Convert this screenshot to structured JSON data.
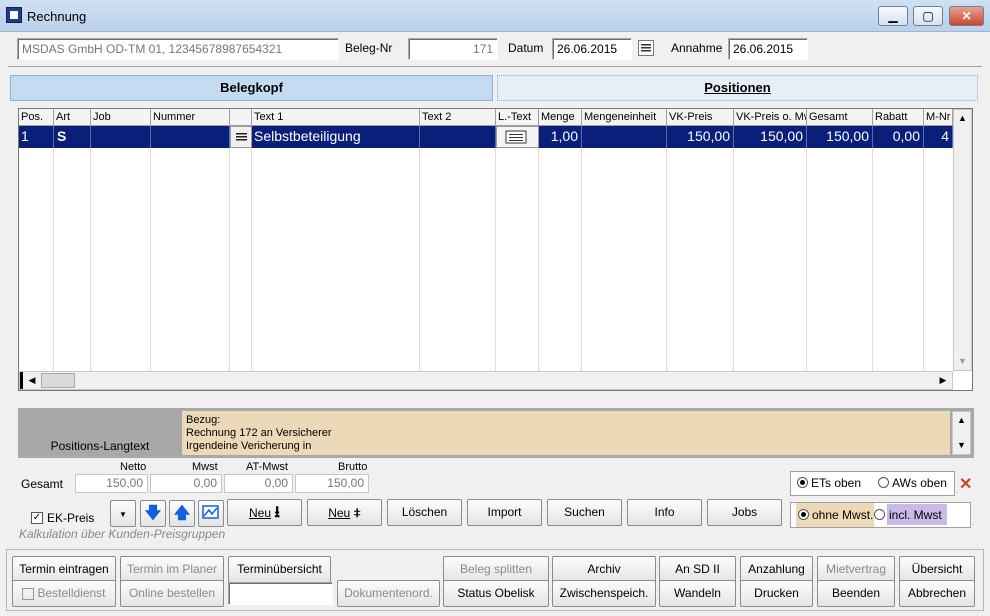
{
  "window": {
    "title": "Rechnung",
    "min": "▁",
    "max": "▢",
    "close": "✕"
  },
  "header": {
    "customer": "MSDAS GmbH OD-TM 01, 12345678987654321",
    "beleg_nr_label": "Beleg-Nr",
    "beleg_nr": "171",
    "datum_label": "Datum",
    "datum": "26.06.2015",
    "annahme_label": "Annahme",
    "annahme": "26.06.2015"
  },
  "tabs": {
    "belegkopf": "Belegkopf",
    "positionen": "Positionen"
  },
  "table": {
    "headers": [
      "Pos.",
      "Art",
      "Job",
      "Nummer",
      "",
      "Text 1",
      "Text 2",
      "L.-Text",
      "Menge",
      "Mengeneinheit",
      "VK-Preis",
      "VK-Preis o. Mwst",
      "Gesamt",
      "Rabatt",
      "M-Nr"
    ],
    "row": [
      "1",
      "S",
      "",
      "",
      "",
      "Selbstbeteiligung",
      "",
      "",
      "1,00",
      "",
      "150,00",
      "150,00",
      "150,00",
      "0,00",
      "4"
    ]
  },
  "langtext": {
    "label": "Positions-Langtext",
    "lines": [
      "Bezug:",
      "Rechnung 172 an Versicherer",
      "Irgendeine Vericherung in"
    ]
  },
  "totals": {
    "label": "Gesamt",
    "netto_label": "Netto",
    "mwst_label": "Mwst",
    "atmwst_label": "AT-Mwst",
    "brutto_label": "Brutto",
    "netto": "150,00",
    "mwst": "0,00",
    "atmwst": "0,00",
    "brutto": "150,00"
  },
  "options": {
    "ets_oben": "ETs oben",
    "aws_oben": "AWs oben",
    "ohne_mwst": "ohne Mwst.",
    "incl_mwst": "incl. Mwst",
    "ek_preis": "EK-Preis",
    "kalkulation": "Kalkulation über Kunden-Preisgruppen"
  },
  "toolbar": {
    "neu1": "Neu",
    "neu2": "Neu",
    "loeschen": "Löschen",
    "import": "Import",
    "suchen": "Suchen",
    "info": "Info",
    "jobs": "Jobs"
  },
  "bottom": {
    "termin_eintragen": "Termin eintragen",
    "termin_planer": "Termin im Planer",
    "terminuebersicht": "Terminübersicht",
    "beleg_splitten": "Beleg splitten",
    "archiv": "Archiv",
    "an_sd": "An SD II",
    "anzahlung": "Anzahlung",
    "mietvertrag": "Mietvertrag",
    "uebersicht": "Übersicht",
    "bestelldienst": "Bestelldienst",
    "online_bestellen": "Online bestellen",
    "dokumentenord": "Dokumentenord.",
    "status_obelisk": "Status Obelisk",
    "zwischenspeich": "Zwischenspeich.",
    "wandeln": "Wandeln",
    "drucken": "Drucken",
    "beenden": "Beenden",
    "abbrechen": "Abbrechen"
  },
  "colors": {
    "selection": "#0a1f7a",
    "tab_active": "#c5dbf2",
    "langtext_bg": "#ecd9b8",
    "close_red": "#c9462c"
  }
}
